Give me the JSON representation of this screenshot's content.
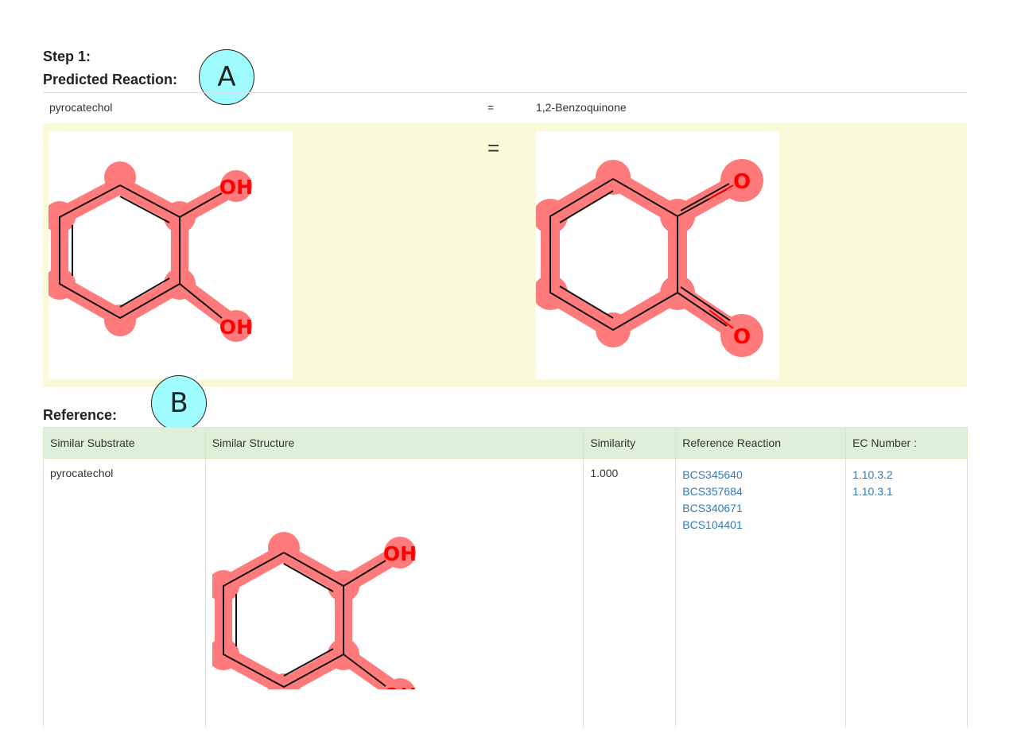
{
  "step": {
    "title": "Step 1:",
    "subtitle": "Predicted Reaction:"
  },
  "reaction": {
    "reactant": "pyrocatechol",
    "operator": "=",
    "product": "1,2-Benzoquinone",
    "structure_operator": "="
  },
  "molecules": {
    "reactant_labels": {
      "top": "OH",
      "bottom": "OH"
    },
    "product_labels": {
      "top": "O",
      "bottom": "O"
    },
    "reference_labels": {
      "top": "OH",
      "bottom": "OH"
    }
  },
  "reference": {
    "title": "Reference:",
    "columns": [
      "Similar Substrate",
      "Similar Structure",
      "Similarity",
      "Reference Reaction",
      "EC Number :"
    ],
    "row": {
      "substrate": "pyrocatechol",
      "similarity": "1.000",
      "reactions": [
        "BCS345640",
        "BCS357684",
        "BCS340671",
        "BCS104401"
      ],
      "ec_numbers": [
        "1.10.3.2",
        "1.10.3.1"
      ]
    }
  },
  "callouts": {
    "a": "A",
    "b": "B"
  },
  "colors": {
    "highlight": "#ff7b7b",
    "atom_label": "#ff0000",
    "panel": "#fafad9",
    "header": "#dff0d8",
    "link": "#337ab7"
  }
}
